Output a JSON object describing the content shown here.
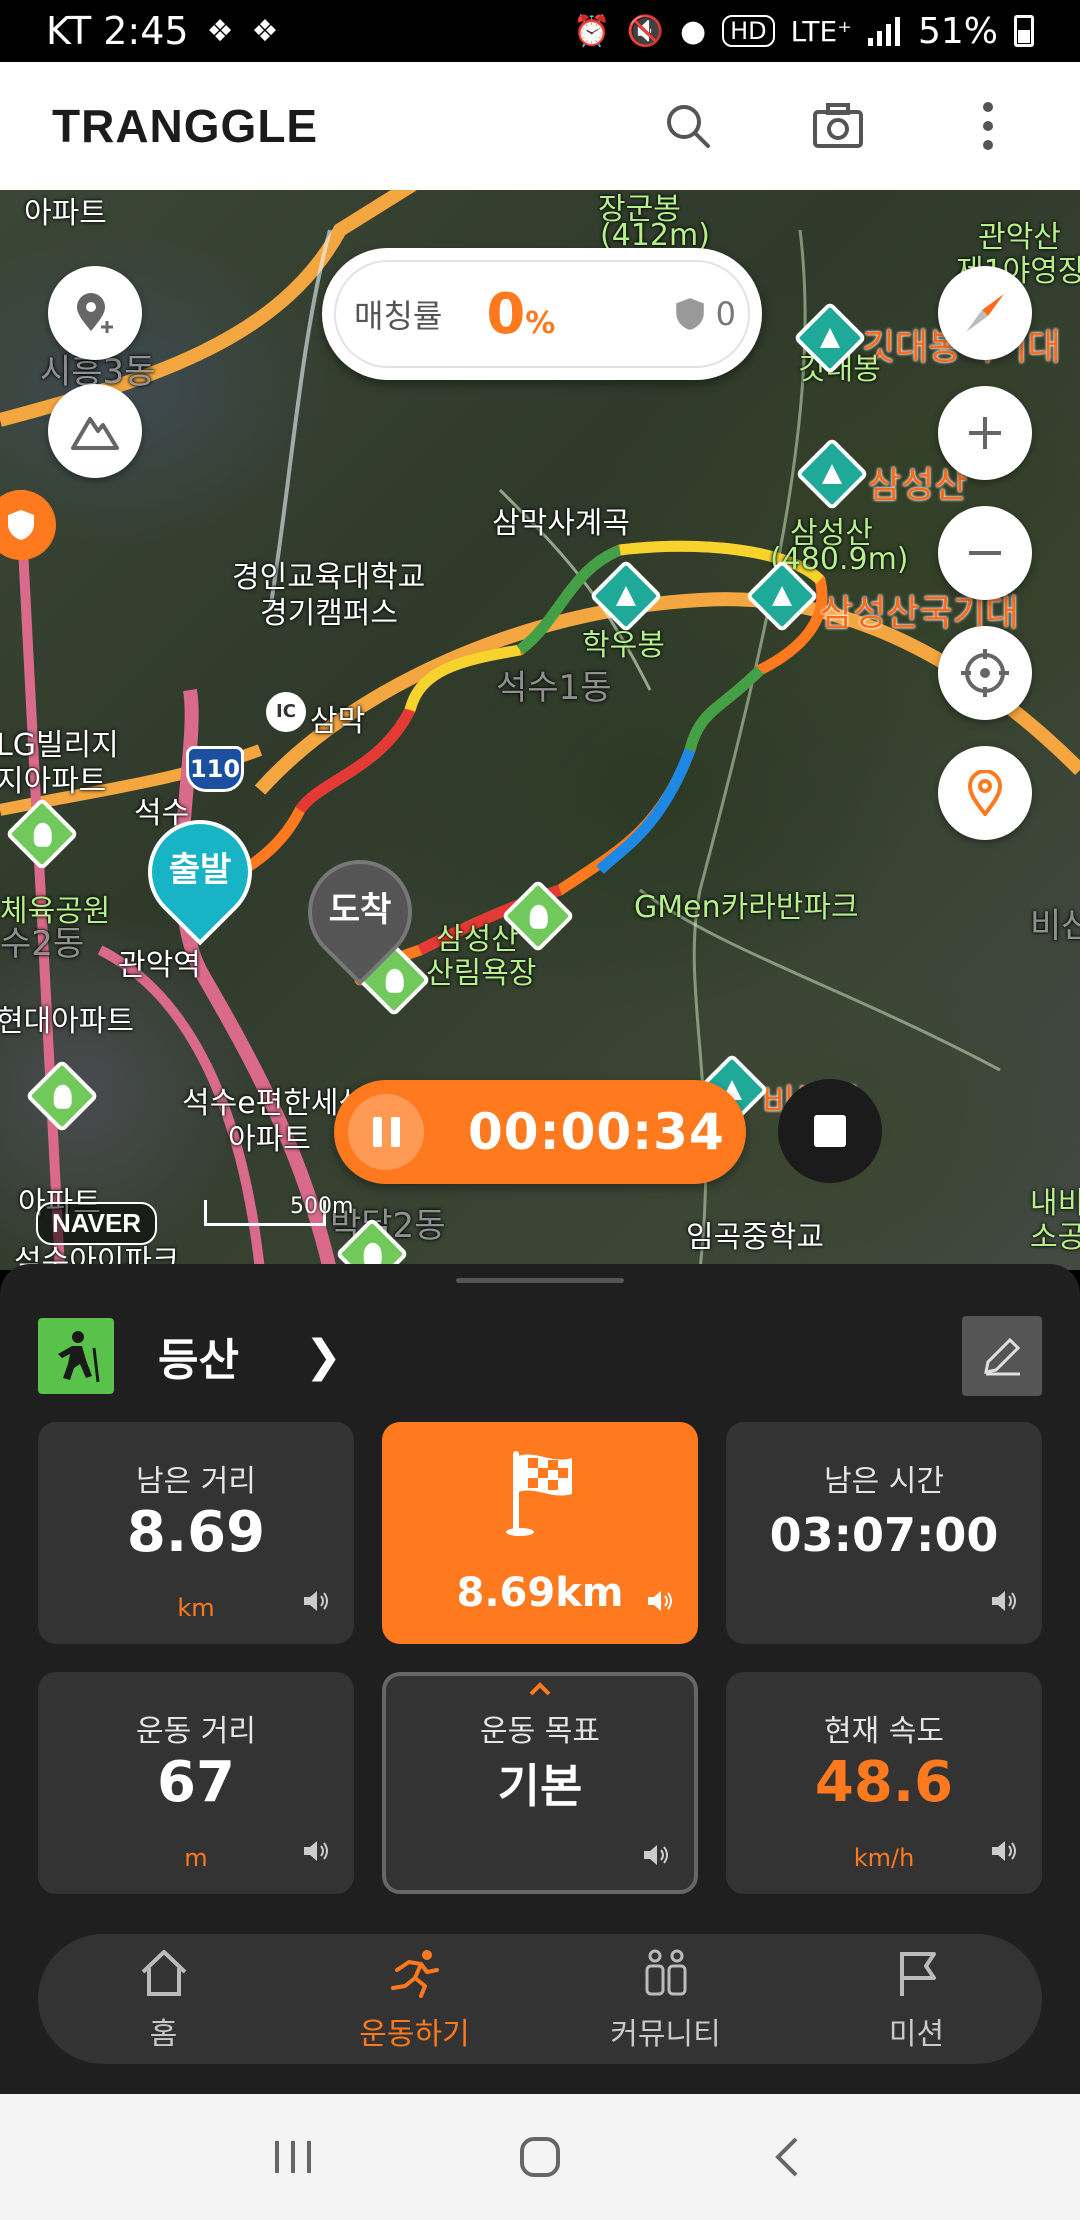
{
  "status_bar": {
    "carrier_time": "KT 2:45",
    "network": "LTE⁺",
    "hd": "HD",
    "battery": "51%"
  },
  "header": {
    "logo": "TRANGGLE"
  },
  "map": {
    "match_label": "매칭률",
    "match_value": "0",
    "match_unit": "%",
    "shield_count": "0",
    "start_label": "출발",
    "end_label": "도착",
    "timer": "00:00:34",
    "naver": "NAVER",
    "scale": "500m",
    "labels": {
      "apt_top": "아파트",
      "peak_top": "장군봉",
      "peak_top_h": "(412m)",
      "gwanaksan": "관악산",
      "camp": "제1야영장",
      "gitdae": "깃대봉국기대",
      "gitbong": "깃대봉",
      "samsung": "삼성산",
      "samsung_peak": "삼성산",
      "samsung_h": "(480.9m)",
      "samsung_flag": "삼성산국기대",
      "samak_valley": "삼막사계곡",
      "univ1": "경인교육대학교",
      "univ2": "경기캠퍼스",
      "hakubong": "학우봉",
      "seoksu1": "석수1동",
      "samak": "삼막",
      "lg1": "LG빌리지",
      "lg2": "지아파트",
      "seoksu": "석수",
      "sports": "체육공원",
      "dong2": "수2동",
      "gwanak_stn": "관악역",
      "gmen": "GMen카라반파크",
      "samsung_forest1": "삼성산",
      "samsung_forest2": "산림욕장",
      "hyundai": "현대아파트",
      "seoksue1": "석수e편한세상",
      "seoksue2": "아파트",
      "bibong": "비봉산",
      "ipa": "아파트",
      "seoksu_ipark": "석수아이파크",
      "bak2": "박달2동",
      "imgok": "임곡중학교",
      "naebi1": "내비",
      "naebi2": "소공",
      "bisan": "비산",
      "siheung3": "시흥3동",
      "hwy": "110",
      "ic": "IC"
    }
  },
  "panel": {
    "activity": "등산",
    "cards": [
      {
        "label": "남은 거리",
        "value": "8.69",
        "unit": "km"
      },
      {
        "goal": "8.69km"
      },
      {
        "label": "남은 시간",
        "value": "03:07:00"
      },
      {
        "label": "운동 거리",
        "value": "67",
        "unit": "m"
      },
      {
        "label": "운동 목표",
        "value": "기본"
      },
      {
        "label": "현재 속도",
        "value": "48.6",
        "unit": "km/h"
      }
    ],
    "nav": [
      {
        "label": "홈",
        "icon": "home-icon"
      },
      {
        "label": "운동하기",
        "icon": "running-icon"
      },
      {
        "label": "커뮤니티",
        "icon": "community-icon"
      },
      {
        "label": "미션",
        "icon": "flag-icon"
      }
    ]
  },
  "colors": {
    "accent": "#ff7a1f",
    "start_marker": "#19b3c6",
    "activity_green": "#58c24b"
  }
}
